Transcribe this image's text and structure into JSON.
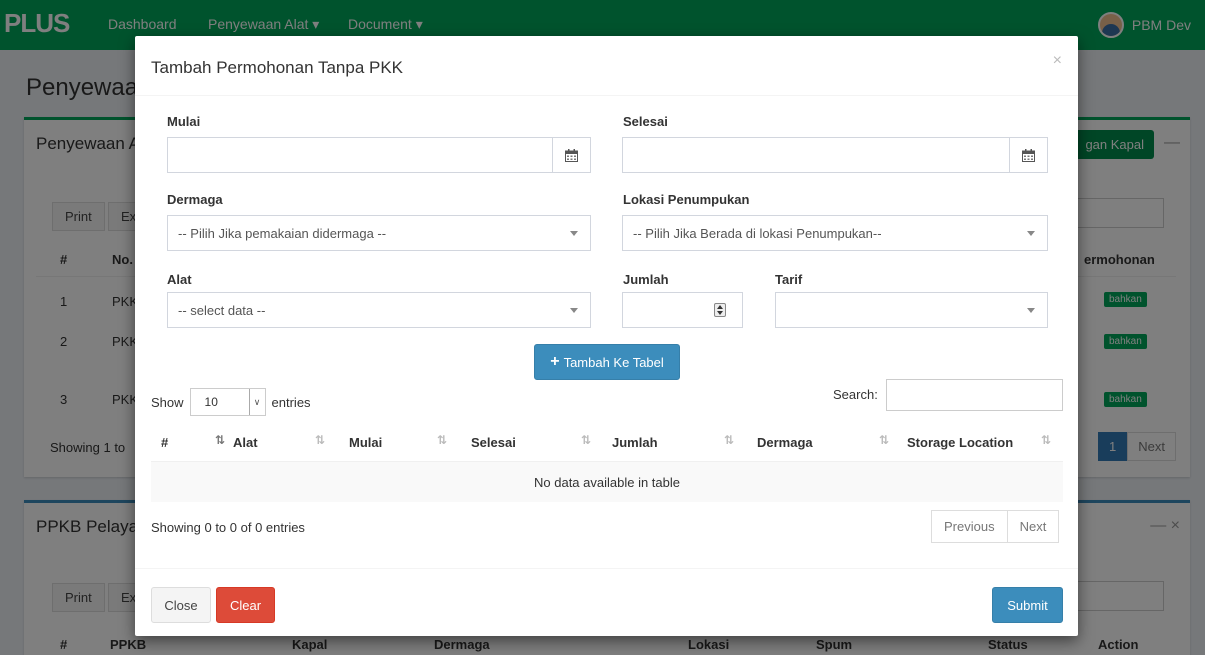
{
  "navbar": {
    "logo": "PLUS",
    "items": [
      "Dashboard",
      "Penyewaan Alat ▾",
      "Document ▾"
    ],
    "user": "PBM Dev"
  },
  "background": {
    "page_title": "Penyewaan",
    "box1": {
      "title": "Penyewaan A",
      "add_button": "gan Kapal",
      "buttons": [
        "Print",
        "Ex"
      ],
      "headers": [
        "#",
        "No.",
        "ermohonan"
      ],
      "rows": [
        {
          "no": "1",
          "code": "PKK",
          "badge": "bahkan"
        },
        {
          "no": "2",
          "code": "PKK",
          "badge": "bahkan"
        },
        {
          "no": "3",
          "code": "PKK",
          "badge": "bahkan"
        }
      ],
      "showing": "Showing 1 to",
      "pager": [
        "1",
        "Next"
      ]
    },
    "box2": {
      "title": "PPKB Pelaya",
      "buttons": [
        "Print",
        "Ex"
      ],
      "headers": [
        "#",
        "PPKB",
        "Kapal",
        "Dermaga",
        "Lokasi",
        "Spum",
        "Status",
        "Action"
      ]
    }
  },
  "modal": {
    "title": "Tambah Permohonan Tanpa PKK",
    "close_glyph": "×",
    "form": {
      "mulai": {
        "label": "Mulai",
        "value": ""
      },
      "selesai": {
        "label": "Selesai",
        "value": ""
      },
      "dermaga": {
        "label": "Dermaga",
        "selected": "-- Pilih Jika pemakaian didermaga --"
      },
      "lokasi": {
        "label": "Lokasi Penumpukan",
        "selected": "-- Pilih Jika Berada di lokasi Penumpukan--"
      },
      "alat": {
        "label": "Alat",
        "selected": "-- select data --"
      },
      "jumlah": {
        "label": "Jumlah",
        "value": ""
      },
      "tarif": {
        "label": "Tarif",
        "selected": ""
      }
    },
    "add_button": "Tambah Ke Tabel",
    "table": {
      "show_label": "Show",
      "length_value": "10",
      "entries_label": "entries",
      "search_label": "Search:",
      "columns": [
        "#",
        "Alat",
        "Mulai",
        "Selesai",
        "Jumlah",
        "Dermaga",
        "Storage Location"
      ],
      "empty": "No data available in table",
      "info": "Showing 0 to 0 of 0 entries",
      "previous": "Previous",
      "next": "Next"
    },
    "footer": {
      "close": "Close",
      "clear": "Clear",
      "submit": "Submit"
    }
  },
  "colors": {
    "brand_green": "#00a65a",
    "primary_blue": "#3c8dbc",
    "danger_red": "#dd4b39"
  }
}
